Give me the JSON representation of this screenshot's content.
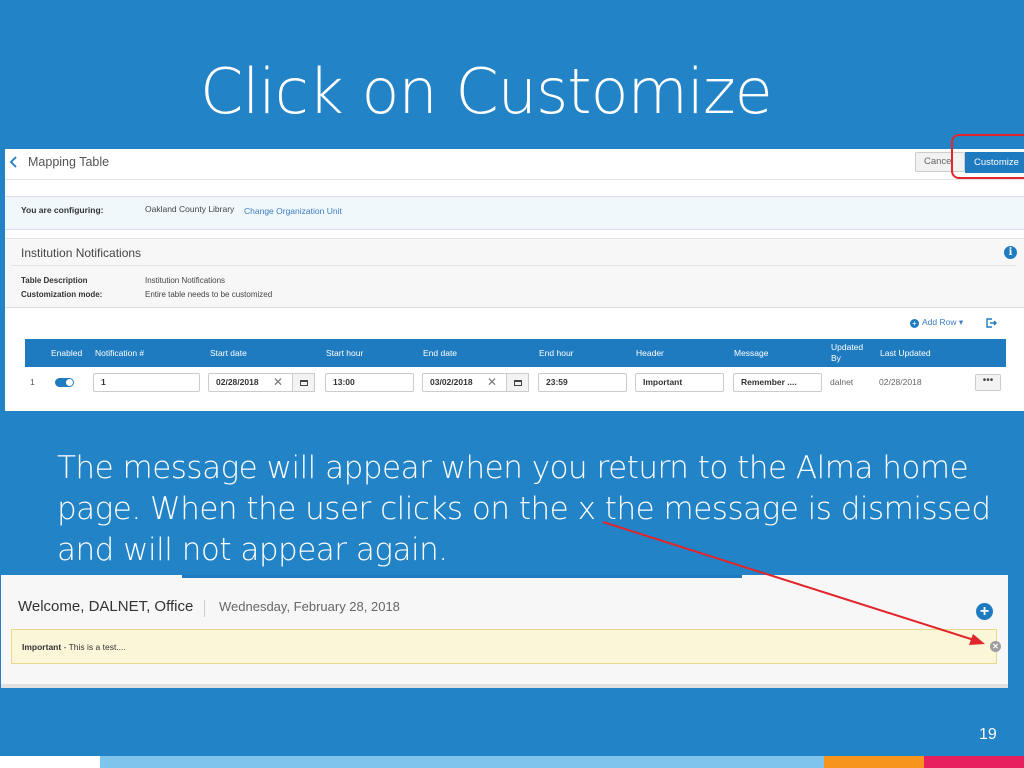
{
  "slide": {
    "title": "Click on Customize",
    "body_text": "The message will appear when you return to the Alma home page.  When the user clicks on the x the message is dismissed and will not appear again.",
    "page_number": "19"
  },
  "mapping_page": {
    "title": "Mapping Table",
    "cancel_label": "Cancel",
    "customize_label": "Customize",
    "configuring_label": "You are configuring:",
    "configuring_value": "Oakland County Library",
    "change_org_link": "Change Organization Unit",
    "section_title": "Institution Notifications",
    "table_description_label": "Table Description",
    "table_description_value": "Institution Notifications",
    "customization_mode_label": "Customization mode:",
    "customization_mode_value": "Entire table needs to be customized",
    "add_row_label": "Add Row",
    "columns": [
      "Enabled",
      "Notification #",
      "Start date",
      "Start hour",
      "End date",
      "End hour",
      "Header",
      "Message",
      "Updated By",
      "Last Updated"
    ],
    "row": {
      "index": "1",
      "enabled": true,
      "notification_number": "1",
      "start_date": "02/28/2018",
      "start_hour": "13:00",
      "end_date": "03/02/2018",
      "end_hour": "23:59",
      "header": "Important",
      "message": "Remember ....",
      "updated_by": "dalnet",
      "last_updated": "02/28/2018",
      "more_label": "•••"
    }
  },
  "home_page": {
    "welcome": "Welcome, DALNET, Office",
    "date": "Wednesday, February 28, 2018",
    "notice_header": "Important",
    "notice_text": " - This is a test...."
  },
  "colors": {
    "slide_bg": "#2383c7",
    "alma_blue": "#1f7bc0",
    "highlight_red": "#e0252b",
    "notice_bg": "#fbf6d8"
  }
}
